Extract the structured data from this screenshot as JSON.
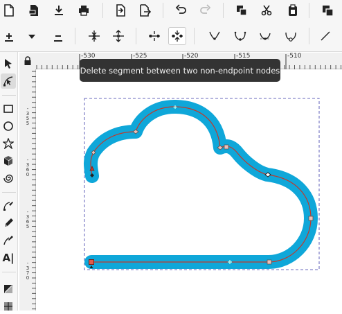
{
  "tooltip": {
    "text": "Delete segment between two non-endpoint nodes"
  },
  "toolbar": {
    "commands": [
      {
        "name": "new-document",
        "icon": "new-document-icon"
      },
      {
        "name": "open-document",
        "icon": "open-document-icon"
      },
      {
        "name": "save-document",
        "icon": "save-icon"
      },
      {
        "name": "print",
        "icon": "print-icon"
      },
      {
        "name": "import",
        "icon": "import-icon"
      },
      {
        "name": "export",
        "icon": "export-icon"
      },
      {
        "name": "undo",
        "icon": "undo-icon"
      },
      {
        "name": "redo",
        "icon": "redo-icon",
        "disabled": true
      },
      {
        "name": "copy",
        "icon": "copy-icon"
      },
      {
        "name": "cut",
        "icon": "cut-icon"
      },
      {
        "name": "paste",
        "icon": "paste-icon"
      },
      {
        "name": "duplicate",
        "icon": "duplicate-icon"
      }
    ],
    "node_tools": [
      {
        "name": "insert-node",
        "icon": "insert-node-icon"
      },
      {
        "name": "insert-node-menu",
        "icon": "chevron-down-icon"
      },
      {
        "name": "delete-node",
        "icon": "delete-node-icon"
      },
      {
        "name": "join-nodes",
        "icon": "join-nodes-icon"
      },
      {
        "name": "break-path",
        "icon": "break-path-icon"
      },
      {
        "name": "join-segment",
        "icon": "join-segment-icon"
      },
      {
        "name": "delete-segment",
        "icon": "delete-segment-icon",
        "pressed": true
      },
      {
        "name": "node-cusp",
        "icon": "node-cusp-icon"
      },
      {
        "name": "node-smooth",
        "icon": "node-smooth-icon"
      },
      {
        "name": "node-symmetric",
        "icon": "node-symmetric-icon"
      },
      {
        "name": "node-auto",
        "icon": "node-auto-icon"
      },
      {
        "name": "segment-line",
        "icon": "segment-line-icon"
      }
    ]
  },
  "toolbox": {
    "tools": [
      {
        "name": "selector",
        "icon": "pointer-icon"
      },
      {
        "name": "node-editor",
        "icon": "node-editor-icon",
        "active": true
      },
      {
        "name": "rectangle",
        "icon": "rectangle-icon"
      },
      {
        "name": "ellipse",
        "icon": "circle-icon"
      },
      {
        "name": "star",
        "icon": "star-icon"
      },
      {
        "name": "3d-box",
        "icon": "3d-box-icon"
      },
      {
        "name": "spiral",
        "icon": "spiral-icon"
      },
      {
        "name": "pen",
        "icon": "pen-icon"
      },
      {
        "name": "pencil",
        "icon": "pencil-icon"
      },
      {
        "name": "calligraphy",
        "icon": "calligraphy-icon"
      },
      {
        "name": "text",
        "label": "A|"
      },
      {
        "name": "gradient",
        "icon": "gradient-icon"
      },
      {
        "name": "mesh",
        "icon": "mesh-icon"
      }
    ]
  },
  "ruler": {
    "horizontal_labels": [
      "-530",
      "-525",
      "-520",
      "-515",
      "-510"
    ],
    "vertical_labels": [
      "-355",
      "-360",
      "-365",
      "-370"
    ]
  },
  "colors": {
    "stroke": "#0fa7d9",
    "path": "#c0392b",
    "tooltip_bg": "#333333",
    "bbox": "#3a3aa8"
  }
}
